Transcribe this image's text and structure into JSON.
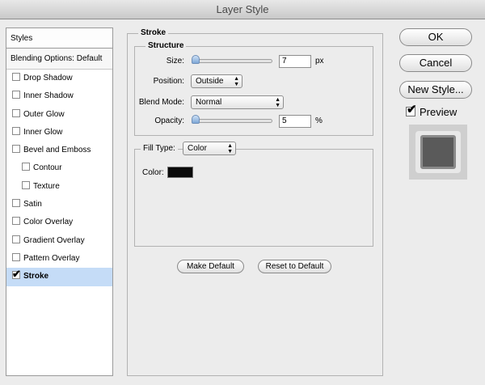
{
  "window": {
    "title": "Layer Style"
  },
  "styles_panel": {
    "header": "Styles",
    "blending_options": "Blending Options: Default",
    "items": [
      {
        "label": "Drop Shadow",
        "checked": false,
        "sub": false
      },
      {
        "label": "Inner Shadow",
        "checked": false,
        "sub": false
      },
      {
        "label": "Outer Glow",
        "checked": false,
        "sub": false
      },
      {
        "label": "Inner Glow",
        "checked": false,
        "sub": false
      },
      {
        "label": "Bevel and Emboss",
        "checked": false,
        "sub": false
      },
      {
        "label": "Contour",
        "checked": false,
        "sub": true
      },
      {
        "label": "Texture",
        "checked": false,
        "sub": true
      },
      {
        "label": "Satin",
        "checked": false,
        "sub": false
      },
      {
        "label": "Color Overlay",
        "checked": false,
        "sub": false
      },
      {
        "label": "Gradient Overlay",
        "checked": false,
        "sub": false
      },
      {
        "label": "Pattern Overlay",
        "checked": false,
        "sub": false
      },
      {
        "label": "Stroke",
        "checked": true,
        "sub": false,
        "selected": true
      }
    ]
  },
  "stroke": {
    "title": "Stroke",
    "structure": {
      "title": "Structure",
      "size_label": "Size:",
      "size_value": "7",
      "size_unit": "px",
      "position_label": "Position:",
      "position_value": "Outside",
      "blend_mode_label": "Blend Mode:",
      "blend_mode_value": "Normal",
      "opacity_label": "Opacity:",
      "opacity_value": "5",
      "opacity_unit": "%"
    },
    "fill": {
      "fill_type_label": "Fill Type:",
      "fill_type_value": "Color",
      "color_label": "Color:",
      "color_value": "#0a0a0a"
    },
    "make_default": "Make Default",
    "reset_to_default": "Reset to Default"
  },
  "buttons": {
    "ok": "OK",
    "cancel": "Cancel",
    "new_style": "New Style..."
  },
  "preview": {
    "label": "Preview",
    "checked": true
  },
  "icons": {
    "check": "✔",
    "select_arrows": "▲▼"
  }
}
